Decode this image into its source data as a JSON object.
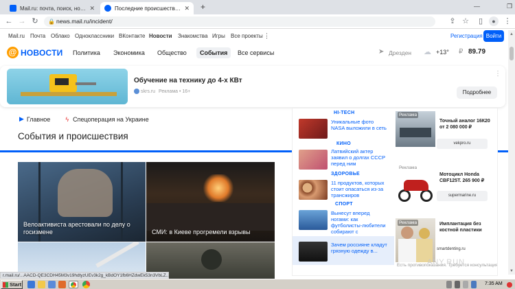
{
  "browser": {
    "tabs": [
      {
        "title": "Mail.ru: почта, поиск, новости, пр",
        "close": "✕"
      },
      {
        "title": "Последние происшествия и собы",
        "close": "✕"
      }
    ],
    "new_tab": "+",
    "url": "news.mail.ru/incident/"
  },
  "mailbar": {
    "items": [
      "Mail.ru",
      "Почта",
      "Облако",
      "Одноклассники",
      "ВКонтакте",
      "Новости",
      "Знакомства",
      "Игры",
      "Все проекты"
    ],
    "register": "Регистрация",
    "login": "Войти"
  },
  "header": {
    "logo_text": "НОВОСТИ",
    "nav": [
      "Политика",
      "Экономика",
      "Общество",
      "События",
      "Все сервисы"
    ],
    "active_nav": "События",
    "city": "Дрезден",
    "temperature": "+13°",
    "currency_value": "89.79"
  },
  "ad": {
    "title": "Обучение на технику до 4-х КВт",
    "source": "skrs.ru",
    "label": "Реклама • 16+",
    "button": "Подробнее"
  },
  "section_nav": {
    "main": "Главное",
    "special": "Спецоперация на Украине"
  },
  "page_title": "События и происшествия",
  "news_cards": [
    {
      "caption": "Велоактивиста арестовали по делу о госизмене"
    },
    {
      "caption": "СМИ: в Киеве прогремели взрывы"
    },
    {
      "caption": ""
    },
    {
      "caption": ""
    }
  ],
  "right_col": {
    "categories": [
      {
        "name": "HI-TECH",
        "headline": "Уникальные фото NASA выложили в сеть"
      },
      {
        "name": "КИНО",
        "headline": "Латвийский актер заявил о долгах СССР перед ним"
      },
      {
        "name": "ЗДОРОВЬЕ",
        "headline": "11 продуктов, которых стоит опасаться из-за трансжиров"
      },
      {
        "name": "СПОРТ",
        "headline": "Вынесут вперед ногами: как футболисты-любители собирают с"
      },
      {
        "name": "",
        "headline": "Зачем россияне кладут грязную одежду в..."
      }
    ],
    "ads": [
      {
        "label": "Реклама",
        "text": "Точный аналог 16К20 от 2 080 000 ₽",
        "button": "vekpro.ru"
      },
      {
        "label": "Реклама",
        "text": "Мотоцикл Honda CBF125T. 265 900 ₽",
        "button": "supermarine.ru"
      },
      {
        "label": "Реклама",
        "text": "Имплантация без костной пластики",
        "button": "smartdenting.ru"
      }
    ],
    "footer_note": "Есть противопоказания. Требуется консультация"
  },
  "status_url": "r.mail.ru/...AACD-QE3CDH45M3v19hdtyzUEv3k2g_kBdOY1fb6HZdwEk53n3VbLZ...",
  "taskbar": {
    "start": "Start",
    "time": "7:35 AM"
  },
  "watermark": "ANY.RUN"
}
